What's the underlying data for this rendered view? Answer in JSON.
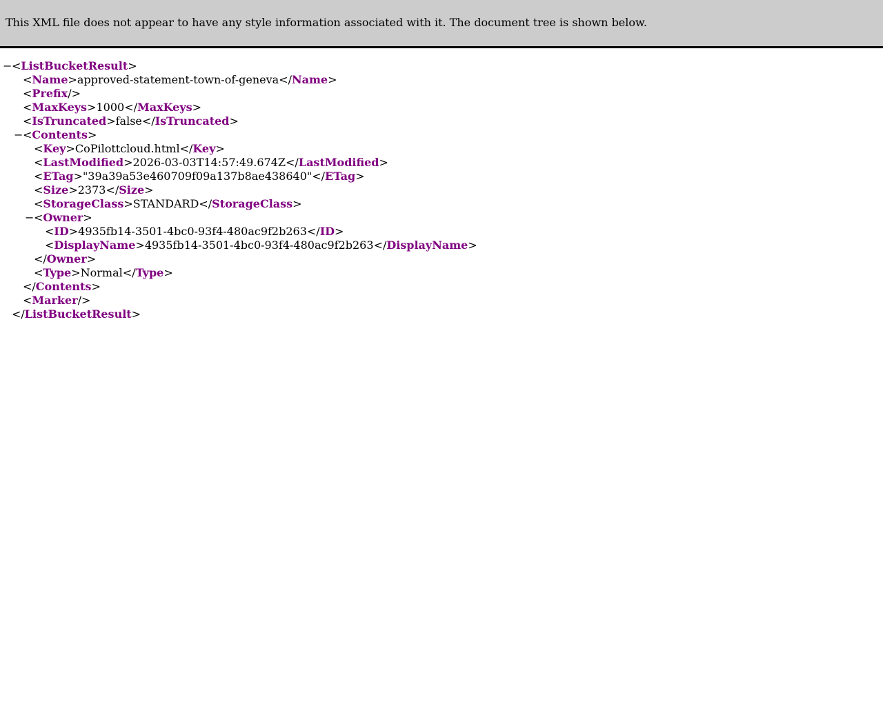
{
  "header": {
    "message": "This XML file does not appear to have any style information associated with it. The document tree is shown below."
  },
  "collapse_symbol": "−",
  "colors": {
    "tag": "#800080",
    "header_bg": "#cccccc"
  },
  "tree": [
    {
      "depth": 0,
      "kind": "open",
      "tag": "ListBucketResult",
      "collapsible": true
    },
    {
      "depth": 1,
      "kind": "leaf",
      "tag": "Name",
      "text": "approved-statement-town-of-geneva"
    },
    {
      "depth": 1,
      "kind": "self",
      "tag": "Prefix"
    },
    {
      "depth": 1,
      "kind": "leaf",
      "tag": "MaxKeys",
      "text": "1000"
    },
    {
      "depth": 1,
      "kind": "leaf",
      "tag": "IsTruncated",
      "text": "false"
    },
    {
      "depth": 1,
      "kind": "open",
      "tag": "Contents",
      "collapsible": true
    },
    {
      "depth": 2,
      "kind": "leaf",
      "tag": "Key",
      "text": "CoPilottcloud.html"
    },
    {
      "depth": 2,
      "kind": "leaf",
      "tag": "LastModified",
      "text": "2026-03-03T14:57:49.674Z"
    },
    {
      "depth": 2,
      "kind": "leaf",
      "tag": "ETag",
      "text": "\"39a39a53e460709f09a137b8ae438640\""
    },
    {
      "depth": 2,
      "kind": "leaf",
      "tag": "Size",
      "text": "2373"
    },
    {
      "depth": 2,
      "kind": "leaf",
      "tag": "StorageClass",
      "text": "STANDARD"
    },
    {
      "depth": 2,
      "kind": "open",
      "tag": "Owner",
      "collapsible": true
    },
    {
      "depth": 3,
      "kind": "leaf",
      "tag": "ID",
      "text": "4935fb14-3501-4bc0-93f4-480ac9f2b263"
    },
    {
      "depth": 3,
      "kind": "leaf",
      "tag": "DisplayName",
      "text": "4935fb14-3501-4bc0-93f4-480ac9f2b263"
    },
    {
      "depth": 2,
      "kind": "close",
      "tag": "Owner"
    },
    {
      "depth": 2,
      "kind": "leaf",
      "tag": "Type",
      "text": "Normal"
    },
    {
      "depth": 1,
      "kind": "close",
      "tag": "Contents"
    },
    {
      "depth": 1,
      "kind": "self",
      "tag": "Marker"
    },
    {
      "depth": 0,
      "kind": "close",
      "tag": "ListBucketResult"
    }
  ]
}
